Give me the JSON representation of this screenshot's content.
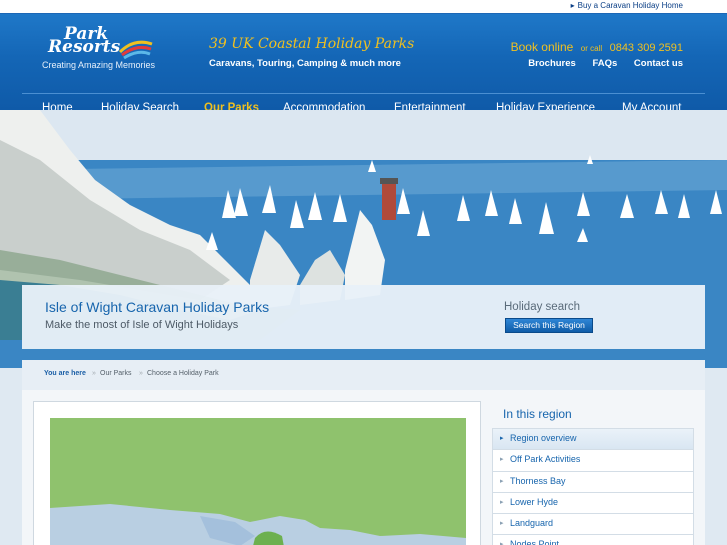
{
  "top_strip": {
    "buy_link": "Buy a Caravan Holiday Home"
  },
  "header": {
    "logo_line1": "Park",
    "logo_line2": "Resorts",
    "tagline": "Creating Amazing Memories",
    "parks_title": "39 UK Coastal Holiday Parks",
    "parks_sub": "Caravans, Touring, Camping & much more",
    "book_online": "Book online",
    "or_call": "or call",
    "phone": "0843 309 2591",
    "links": [
      "Brochures",
      "FAQs",
      "Contact us"
    ]
  },
  "nav": {
    "items": [
      "Home",
      "Holiday Search",
      "Our Parks",
      "Accommodation",
      "Entertainment",
      "Holiday Experience",
      "My Account"
    ],
    "active": "Our Parks"
  },
  "banner": {
    "title": "Isle of Wight Caravan Holiday Parks",
    "subtitle": "Make the most of Isle of Wight Holidays",
    "holiday_search": "Holiday search",
    "search_button": "Search this Region"
  },
  "breadcrumb": {
    "you_are_here": "You are here",
    "items": [
      "Our Parks",
      "Choose a Holiday Park"
    ]
  },
  "region_panel": {
    "title": "In this region",
    "items": [
      "Region overview",
      "Off Park Activities",
      "Thorness Bay",
      "Lower Hyde",
      "Landguard",
      "Nodes Point"
    ]
  },
  "colors": {
    "header_blue": "#1466b6",
    "accent_yellow": "#f0c020",
    "link_blue": "#1765ad",
    "map_green": "#8fc26d"
  }
}
